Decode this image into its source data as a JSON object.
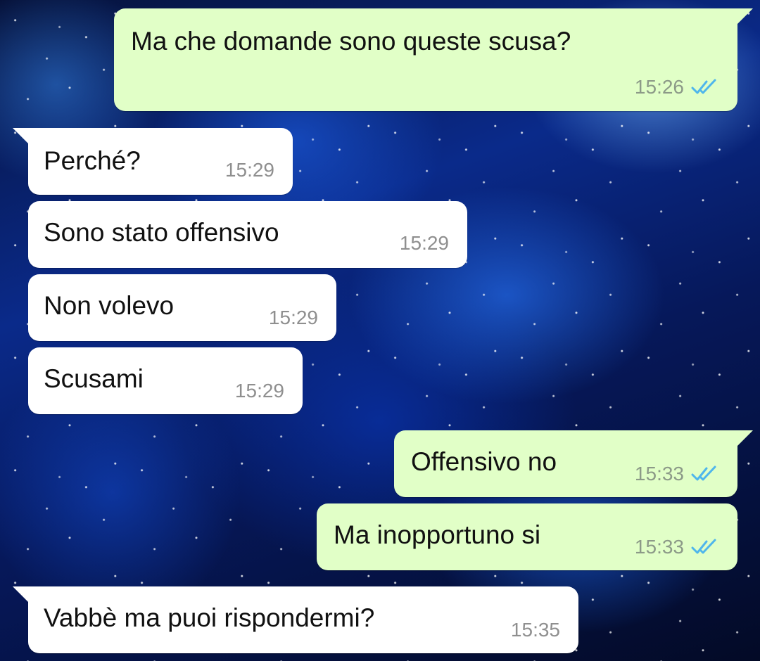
{
  "chat": {
    "messages": [
      {
        "direction": "outgoing",
        "text": "Ma che domande sono queste scusa?",
        "time": "15:26",
        "status": "read-check-icon"
      },
      {
        "direction": "incoming",
        "text": "Perché?",
        "time": "15:29"
      },
      {
        "direction": "incoming",
        "text": "Sono stato offensivo",
        "time": "15:29"
      },
      {
        "direction": "incoming",
        "text": "Non volevo",
        "time": "15:29"
      },
      {
        "direction": "incoming",
        "text": "Scusami",
        "time": "15:29"
      },
      {
        "direction": "outgoing",
        "text": "Offensivo no",
        "time": "15:33",
        "status": "read-check-icon"
      },
      {
        "direction": "outgoing",
        "text": "Ma inopportuno si",
        "time": "15:33",
        "status": "read-check-icon"
      },
      {
        "direction": "incoming",
        "text": "Vabbè ma puoi rispondermi?",
        "time": "15:35"
      }
    ]
  },
  "colors": {
    "outgoing_bubble": "#e1ffc7",
    "incoming_bubble": "#ffffff",
    "read_ticks": "#4fb6ec",
    "background": "#0a2a8a"
  }
}
